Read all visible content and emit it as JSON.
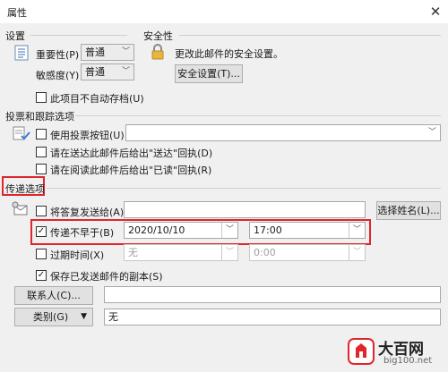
{
  "window": {
    "title": "属性",
    "close_glyph": "✕"
  },
  "settings": {
    "section_title": "设置",
    "importance": {
      "label": "重要性(P)",
      "value": "普通"
    },
    "sensitivity": {
      "label": "敏感度(Y)",
      "value": "普通"
    },
    "no_autoarchive": {
      "label": "此项目不自动存档(U)",
      "checked": false
    }
  },
  "security": {
    "section_title": "安全性",
    "description": "更改此邮件的安全设置。",
    "button_label": "安全设置(T)..."
  },
  "voting": {
    "section_title": "投票和跟踪选项",
    "use_voting": {
      "label": "使用投票按钮(U)",
      "checked": false,
      "value": ""
    },
    "delivery_receipt": {
      "label": "请在送达此邮件后给出\"送达\"回执(D)",
      "checked": false
    },
    "read_receipt": {
      "label": "请在阅读此邮件后给出\"已读\"回执(R)",
      "checked": false
    }
  },
  "delivery": {
    "section_title": "传递选项",
    "reply_to": {
      "label": "将答复发送给(A)",
      "checked": false,
      "value": ""
    },
    "select_names_label": "选择姓名(L)...",
    "do_not_deliver_before": {
      "label": "传递不早于(B)",
      "checked": true,
      "date": "2020/10/10",
      "time": "17:00"
    },
    "expires_after": {
      "label": "过期时间(X)",
      "checked": false,
      "date": "无",
      "time": "0:00"
    },
    "save_copy": {
      "label": "保存已发送邮件的副本(S)",
      "checked": true
    }
  },
  "contacts": {
    "button_label": "联系人(C)...",
    "value": ""
  },
  "categories": {
    "button_label": "类别(G)",
    "value": "无"
  },
  "watermark": {
    "text": "大百网",
    "url": "big100.net"
  },
  "colors": {
    "highlight": "#e0262b",
    "background": "#f0f0f0"
  }
}
